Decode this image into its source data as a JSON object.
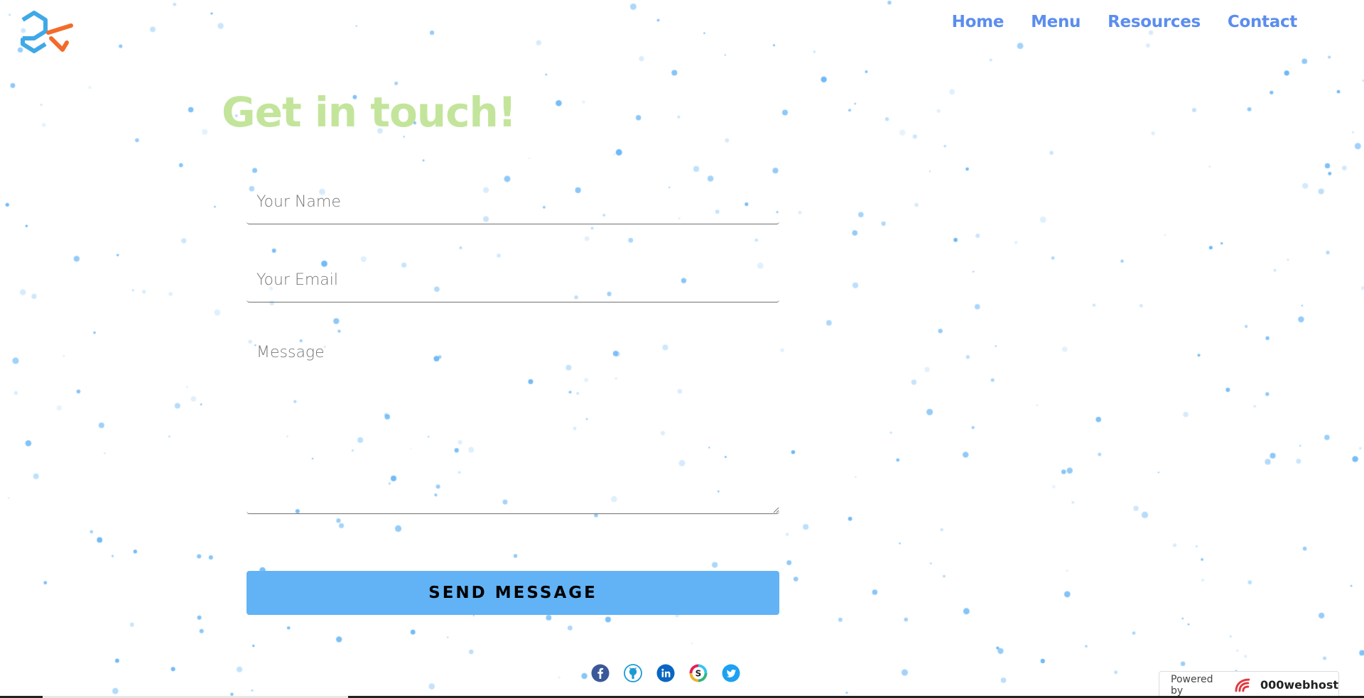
{
  "nav": {
    "items": [
      "Home",
      "Menu",
      "Resources",
      "Contact"
    ]
  },
  "hero": {
    "title": "Get in touch!"
  },
  "form": {
    "name_placeholder": "Your Name",
    "email_placeholder": "Your Email",
    "message_placeholder": "Message",
    "submit_label": "SEND MESSAGE"
  },
  "social": [
    "facebook-icon",
    "github-icon",
    "linkedin-icon",
    "slack-icon",
    "twitter-icon"
  ],
  "footer": {
    "powered_label": "Powered by",
    "powered_brand": "000webhost"
  },
  "colors": {
    "nav": "#5b8def",
    "title": "#c3e59b",
    "button": "#62b3f5",
    "particles": "#62b3f5",
    "logo_blue": "#3ea9e6",
    "logo_orange": "#f26b2a"
  }
}
